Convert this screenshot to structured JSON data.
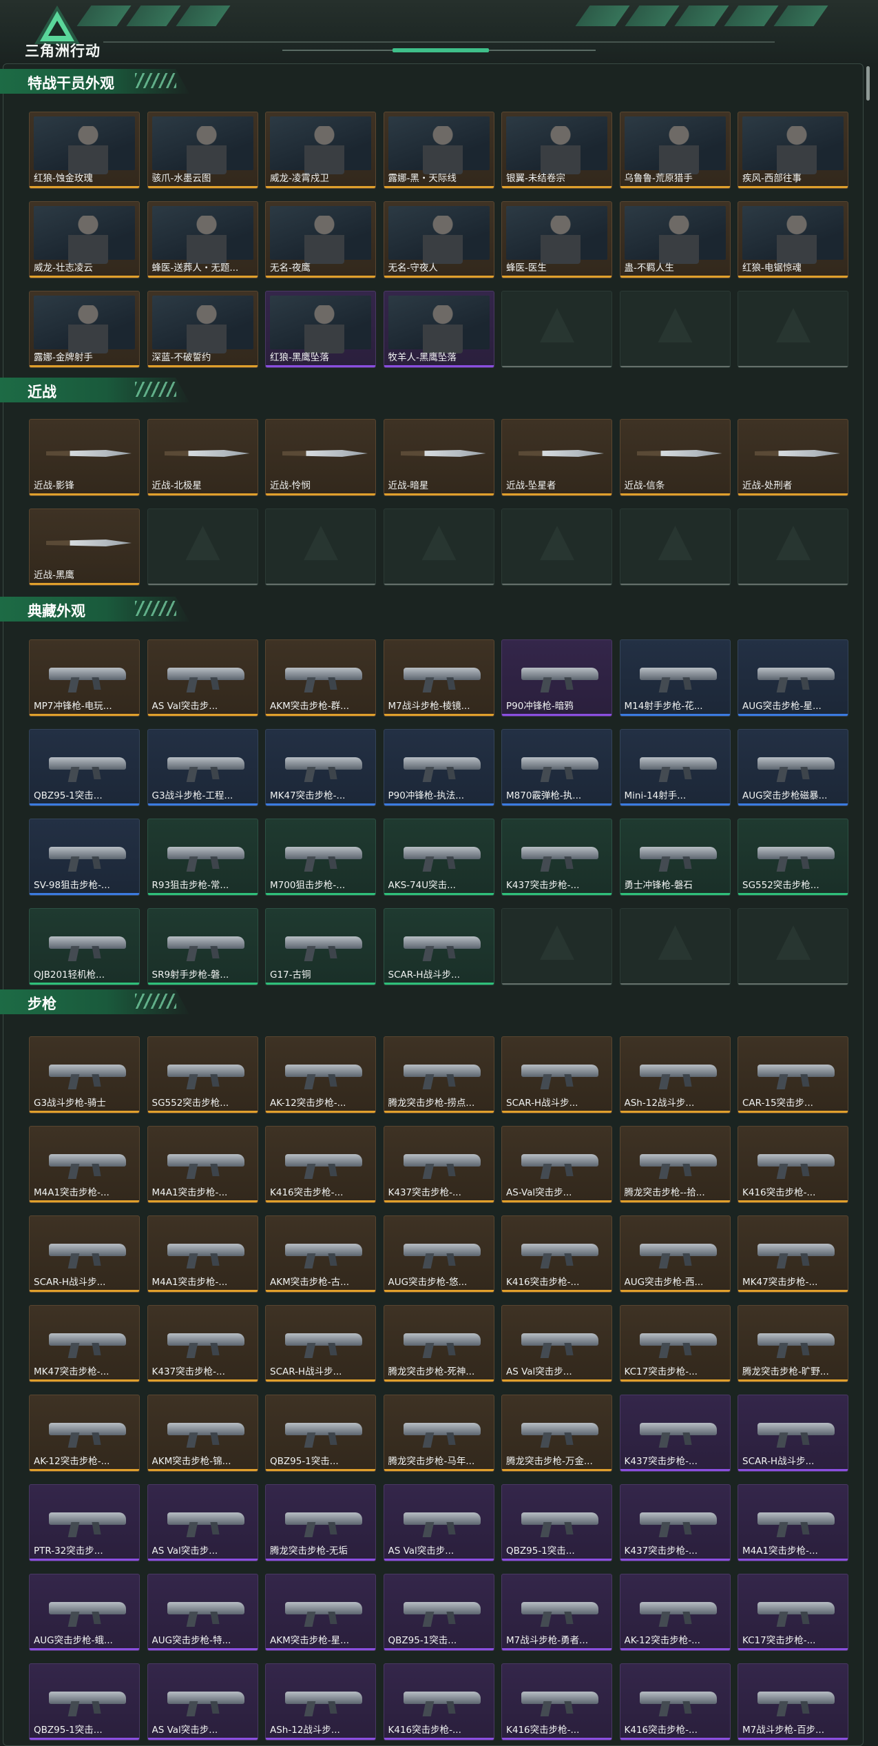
{
  "app": {
    "title": "三角洲行动"
  },
  "sections": [
    {
      "title": "特战干员外观",
      "items": [
        {
          "name": "红狼-蚀金玫瑰",
          "tier": "gold",
          "kind": "operator"
        },
        {
          "name": "骇爪-水墨云图",
          "tier": "gold",
          "kind": "operator"
        },
        {
          "name": "威龙-凌霄戍卫",
          "tier": "gold",
          "kind": "operator"
        },
        {
          "name": "露娜-黑・天际线",
          "tier": "gold",
          "kind": "operator"
        },
        {
          "name": "银翼-未结卷宗",
          "tier": "gold",
          "kind": "operator"
        },
        {
          "name": "乌鲁鲁-荒原猎手",
          "tier": "gold",
          "kind": "operator"
        },
        {
          "name": "疾风-西部往事",
          "tier": "gold",
          "kind": "operator"
        },
        {
          "name": "威龙-壮志凌云",
          "tier": "gold",
          "kind": "operator"
        },
        {
          "name": "蜂医-送葬人・无题...",
          "tier": "gold",
          "kind": "operator"
        },
        {
          "name": "无名-夜鹰",
          "tier": "gold",
          "kind": "operator"
        },
        {
          "name": "无名-守夜人",
          "tier": "gold",
          "kind": "operator"
        },
        {
          "name": "蜂医-医生",
          "tier": "gold",
          "kind": "operator"
        },
        {
          "name": "蛊-不羁人生",
          "tier": "gold",
          "kind": "operator"
        },
        {
          "name": "红狼-电锯惊魂",
          "tier": "gold",
          "kind": "operator"
        },
        {
          "name": "露娜-金牌射手",
          "tier": "gold",
          "kind": "operator"
        },
        {
          "name": "深蓝-不破誓约",
          "tier": "gold",
          "kind": "operator"
        },
        {
          "name": "红狼-黑鹰坠落",
          "tier": "purple",
          "kind": "operator"
        },
        {
          "name": "牧羊人-黑鹰坠落",
          "tier": "purple",
          "kind": "operator"
        },
        {
          "name": "",
          "tier": "empty",
          "kind": "empty"
        },
        {
          "name": "",
          "tier": "empty",
          "kind": "empty"
        },
        {
          "name": "",
          "tier": "empty",
          "kind": "empty"
        }
      ]
    },
    {
      "title": "近战",
      "items": [
        {
          "name": "近战-影锋",
          "tier": "gold",
          "kind": "blade"
        },
        {
          "name": "近战-北极星",
          "tier": "gold",
          "kind": "blade"
        },
        {
          "name": "近战-怜悯",
          "tier": "gold",
          "kind": "blade"
        },
        {
          "name": "近战-暗星",
          "tier": "gold",
          "kind": "blade"
        },
        {
          "name": "近战-坠星者",
          "tier": "gold",
          "kind": "blade"
        },
        {
          "name": "近战-信条",
          "tier": "gold",
          "kind": "blade"
        },
        {
          "name": "近战-处刑者",
          "tier": "gold",
          "kind": "blade"
        },
        {
          "name": "近战-黑鹰",
          "tier": "gold",
          "kind": "blade"
        },
        {
          "name": "",
          "tier": "empty",
          "kind": "empty"
        },
        {
          "name": "",
          "tier": "empty",
          "kind": "empty"
        },
        {
          "name": "",
          "tier": "empty",
          "kind": "empty"
        },
        {
          "name": "",
          "tier": "empty",
          "kind": "empty"
        },
        {
          "name": "",
          "tier": "empty",
          "kind": "empty"
        },
        {
          "name": "",
          "tier": "empty",
          "kind": "empty"
        }
      ]
    },
    {
      "title": "典藏外观",
      "items": [
        {
          "name": "MP7冲锋枪-电玩...",
          "tier": "gold",
          "kind": "gun"
        },
        {
          "name": "AS Val突击步...",
          "tier": "gold",
          "kind": "gun"
        },
        {
          "name": "AKM突击步枪-群...",
          "tier": "gold",
          "kind": "gun"
        },
        {
          "name": "M7战斗步枪-棱镜...",
          "tier": "gold",
          "kind": "gun"
        },
        {
          "name": "P90冲锋枪-暗鸦",
          "tier": "purple",
          "kind": "gun"
        },
        {
          "name": "M14射手步枪-花...",
          "tier": "blue",
          "kind": "gun"
        },
        {
          "name": "AUG突击步枪-星...",
          "tier": "blue",
          "kind": "gun"
        },
        {
          "name": "QBZ95-1突击...",
          "tier": "blue",
          "kind": "gun"
        },
        {
          "name": "G3战斗步枪-工程...",
          "tier": "blue",
          "kind": "gun"
        },
        {
          "name": "MK47突击步枪-...",
          "tier": "blue",
          "kind": "gun"
        },
        {
          "name": "P90冲锋枪-执法...",
          "tier": "blue",
          "kind": "gun"
        },
        {
          "name": "M870霰弹枪-执...",
          "tier": "blue",
          "kind": "gun"
        },
        {
          "name": "Mini-14射手...",
          "tier": "blue",
          "kind": "gun"
        },
        {
          "name": "AUG突击步枪磁暴...",
          "tier": "blue",
          "kind": "gun"
        },
        {
          "name": "SV-98狙击步枪-...",
          "tier": "blue",
          "kind": "gun"
        },
        {
          "name": "R93狙击步枪-常...",
          "tier": "green",
          "kind": "gun"
        },
        {
          "name": "M700狙击步枪-...",
          "tier": "green",
          "kind": "gun"
        },
        {
          "name": "AKS-74U突击...",
          "tier": "green",
          "kind": "gun"
        },
        {
          "name": "K437突击步枪-...",
          "tier": "green",
          "kind": "gun"
        },
        {
          "name": "勇士冲锋枪-磐石",
          "tier": "green",
          "kind": "gun"
        },
        {
          "name": "SG552突击步枪...",
          "tier": "green",
          "kind": "gun"
        },
        {
          "name": "QJB201轻机枪...",
          "tier": "green",
          "kind": "gun"
        },
        {
          "name": "SR9射手步枪-磐...",
          "tier": "green",
          "kind": "gun"
        },
        {
          "name": "G17-古铜",
          "tier": "green",
          "kind": "gun"
        },
        {
          "name": "SCAR-H战斗步...",
          "tier": "green",
          "kind": "gun"
        },
        {
          "name": "",
          "tier": "empty",
          "kind": "empty"
        },
        {
          "name": "",
          "tier": "empty",
          "kind": "empty"
        },
        {
          "name": "",
          "tier": "empty",
          "kind": "empty"
        }
      ]
    },
    {
      "title": "步枪",
      "items": [
        {
          "name": "G3战斗步枪-骑士",
          "tier": "gold",
          "kind": "gun"
        },
        {
          "name": "SG552突击步枪...",
          "tier": "gold",
          "kind": "gun"
        },
        {
          "name": "AK-12突击步枪-...",
          "tier": "gold",
          "kind": "gun"
        },
        {
          "name": "腾龙突击步枪-捞点...",
          "tier": "gold",
          "kind": "gun"
        },
        {
          "name": "SCAR-H战斗步...",
          "tier": "gold",
          "kind": "gun"
        },
        {
          "name": "ASh-12战斗步...",
          "tier": "gold",
          "kind": "gun"
        },
        {
          "name": "CAR-15突击步...",
          "tier": "gold",
          "kind": "gun"
        },
        {
          "name": "M4A1突击步枪-...",
          "tier": "gold",
          "kind": "gun"
        },
        {
          "name": "M4A1突击步枪-...",
          "tier": "gold",
          "kind": "gun"
        },
        {
          "name": "K416突击步枪-...",
          "tier": "gold",
          "kind": "gun"
        },
        {
          "name": "K437突击步枪-...",
          "tier": "gold",
          "kind": "gun"
        },
        {
          "name": "AS-Val突击步...",
          "tier": "gold",
          "kind": "gun"
        },
        {
          "name": "腾龙突击步枪--拾...",
          "tier": "gold",
          "kind": "gun"
        },
        {
          "name": "K416突击步枪-...",
          "tier": "gold",
          "kind": "gun"
        },
        {
          "name": "SCAR-H战斗步...",
          "tier": "gold",
          "kind": "gun"
        },
        {
          "name": "M4A1突击步枪-...",
          "tier": "gold",
          "kind": "gun"
        },
        {
          "name": "AKM突击步枪-古...",
          "tier": "gold",
          "kind": "gun"
        },
        {
          "name": "AUG突击步枪-悠...",
          "tier": "gold",
          "kind": "gun"
        },
        {
          "name": "K416突击步枪-...",
          "tier": "gold",
          "kind": "gun"
        },
        {
          "name": "AUG突击步枪-西...",
          "tier": "gold",
          "kind": "gun"
        },
        {
          "name": "MK47突击步枪-...",
          "tier": "gold",
          "kind": "gun"
        },
        {
          "name": "MK47突击步枪-...",
          "tier": "gold",
          "kind": "gun"
        },
        {
          "name": "K437突击步枪-...",
          "tier": "gold",
          "kind": "gun"
        },
        {
          "name": "SCAR-H战斗步...",
          "tier": "gold",
          "kind": "gun"
        },
        {
          "name": "腾龙突击步枪-死神...",
          "tier": "gold",
          "kind": "gun"
        },
        {
          "name": "AS Val突击步...",
          "tier": "gold",
          "kind": "gun"
        },
        {
          "name": "KC17突击步枪-...",
          "tier": "gold",
          "kind": "gun"
        },
        {
          "name": "腾龙突击步枪-旷野...",
          "tier": "gold",
          "kind": "gun"
        },
        {
          "name": "AK-12突击步枪-...",
          "tier": "gold",
          "kind": "gun"
        },
        {
          "name": "AKM突击步枪-锦...",
          "tier": "gold",
          "kind": "gun"
        },
        {
          "name": "QBZ95-1突击...",
          "tier": "gold",
          "kind": "gun"
        },
        {
          "name": "腾龙突击步枪-马年...",
          "tier": "gold",
          "kind": "gun"
        },
        {
          "name": "腾龙突击步枪-万金...",
          "tier": "gold",
          "kind": "gun"
        },
        {
          "name": "K437突击步枪-...",
          "tier": "purple",
          "kind": "gun"
        },
        {
          "name": "SCAR-H战斗步...",
          "tier": "purple",
          "kind": "gun"
        },
        {
          "name": "PTR-32突击步...",
          "tier": "purple",
          "kind": "gun"
        },
        {
          "name": "AS Val突击步...",
          "tier": "purple",
          "kind": "gun"
        },
        {
          "name": "腾龙突击步枪-无垢",
          "tier": "purple",
          "kind": "gun"
        },
        {
          "name": "AS Val突击步...",
          "tier": "purple",
          "kind": "gun"
        },
        {
          "name": "QBZ95-1突击...",
          "tier": "purple",
          "kind": "gun"
        },
        {
          "name": "K437突击步枪-...",
          "tier": "purple",
          "kind": "gun"
        },
        {
          "name": "M4A1突击步枪-...",
          "tier": "purple",
          "kind": "gun"
        },
        {
          "name": "AUG突击步枪-蛾...",
          "tier": "purple",
          "kind": "gun"
        },
        {
          "name": "AUG突击步枪-特...",
          "tier": "purple",
          "kind": "gun"
        },
        {
          "name": "AKM突击步枪-星...",
          "tier": "purple",
          "kind": "gun"
        },
        {
          "name": "QBZ95-1突击...",
          "tier": "purple",
          "kind": "gun"
        },
        {
          "name": "M7战斗步枪-勇者...",
          "tier": "purple",
          "kind": "gun"
        },
        {
          "name": "AK-12突击步枪-...",
          "tier": "purple",
          "kind": "gun"
        },
        {
          "name": "KC17突击步枪-...",
          "tier": "purple",
          "kind": "gun"
        },
        {
          "name": "QBZ95-1突击...",
          "tier": "purple",
          "kind": "gun"
        },
        {
          "name": "AS Val突击步...",
          "tier": "purple",
          "kind": "gun"
        },
        {
          "name": "ASh-12战斗步...",
          "tier": "purple",
          "kind": "gun"
        },
        {
          "name": "K416突击步枪-...",
          "tier": "purple",
          "kind": "gun"
        },
        {
          "name": "K416突击步枪-...",
          "tier": "purple",
          "kind": "gun"
        },
        {
          "name": "K416突击步枪-...",
          "tier": "purple",
          "kind": "gun"
        },
        {
          "name": "M7战斗步枪-百步...",
          "tier": "purple",
          "kind": "gun"
        }
      ]
    }
  ]
}
